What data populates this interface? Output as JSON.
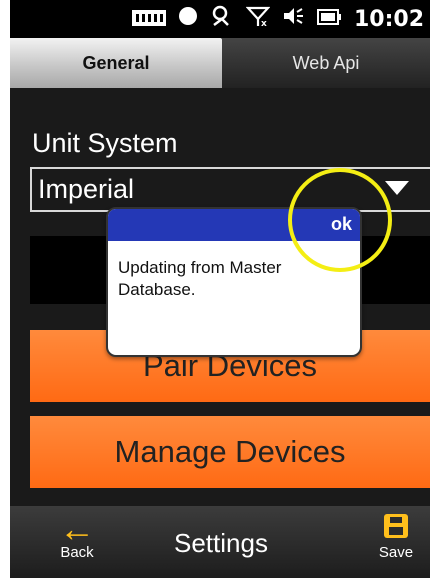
{
  "status_bar": {
    "time": "10:02",
    "icons": [
      "signal-bars-icon",
      "status-dot-icon",
      "sync-icon",
      "no-signal-icon",
      "volume-icon",
      "battery-icon"
    ]
  },
  "tabs": [
    {
      "label": "General",
      "selected": true
    },
    {
      "label": "Web Api",
      "selected": false
    }
  ],
  "settings": {
    "unit_label": "Unit System",
    "unit_value": "Imperial"
  },
  "buttons": {
    "pair": "Pair Devices",
    "manage": "Manage Devices"
  },
  "dialog": {
    "ok_label": "ok",
    "message": "Updating from Master Database."
  },
  "bottom_bar": {
    "back_label": "Back",
    "title": "Settings",
    "save_label": "Save"
  },
  "colors": {
    "accent_orange": "#ff6a14",
    "dialog_header": "#2438b6",
    "highlight": "#f4ee14",
    "icon_yellow": "#ffbf1c"
  }
}
